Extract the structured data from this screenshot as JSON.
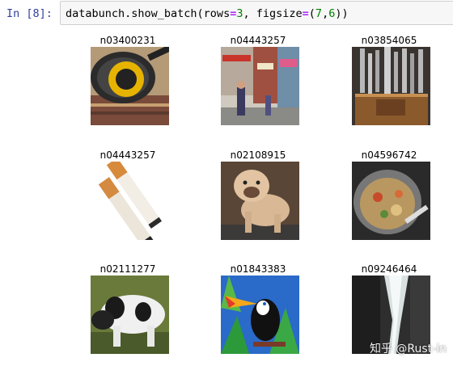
{
  "cell": {
    "prompt": "In [8]:",
    "code": {
      "prefix": "databunch.show_batch(rows",
      "eq1": "=",
      "rows_value": "3",
      "mid": ", figsize",
      "eq2": "=",
      "open": "(",
      "w": "7",
      "comma": ",",
      "h": "6",
      "close": "))"
    }
  },
  "batch": {
    "labels": [
      "n03400231",
      "n04443257",
      "n03854065",
      "n04443257",
      "n02108915",
      "n04596742",
      "n02111277",
      "n01843383",
      "n09246464"
    ],
    "image_subjects": [
      "frying-pan",
      "street-shops",
      "pipe-organ",
      "cigarettes",
      "bulldog",
      "wok-food",
      "newfoundland-dog",
      "toucan-painting",
      "cliff-crevice"
    ]
  },
  "watermark": "知乎 @Rust-in"
}
